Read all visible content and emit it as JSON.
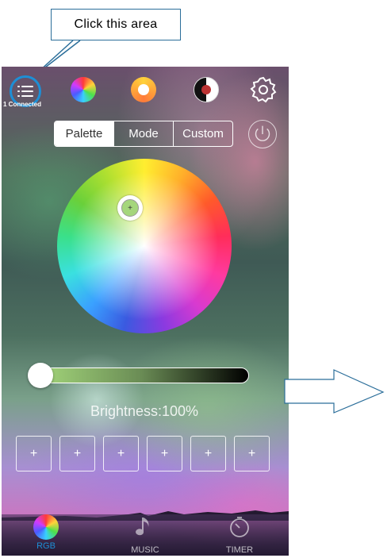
{
  "callout": {
    "text": "Click this area"
  },
  "header": {
    "connected_label": "1 Connected",
    "icons": [
      "menu-icon",
      "rgb-color-icon",
      "ring-color-icon",
      "black-white-icon",
      "settings-gear-icon"
    ]
  },
  "tabs": [
    {
      "label": "Palette",
      "selected": true
    },
    {
      "label": "Mode",
      "selected": false
    },
    {
      "label": "Custom",
      "selected": false
    }
  ],
  "color_wheel": {
    "selected_color": "#a5d67c"
  },
  "brightness": {
    "label": "Brightness:100%",
    "value_percent": 100
  },
  "slots": [
    "+",
    "+",
    "+",
    "+",
    "+",
    "+"
  ],
  "nav": [
    {
      "label": "RGB",
      "active": true,
      "color": "#1d8fd6"
    },
    {
      "label": "MUSIC",
      "active": false
    },
    {
      "label": "TIMER",
      "active": false
    }
  ],
  "colors": {
    "accent": "#1d8fd6",
    "callout_border": "#2b6e9a"
  }
}
